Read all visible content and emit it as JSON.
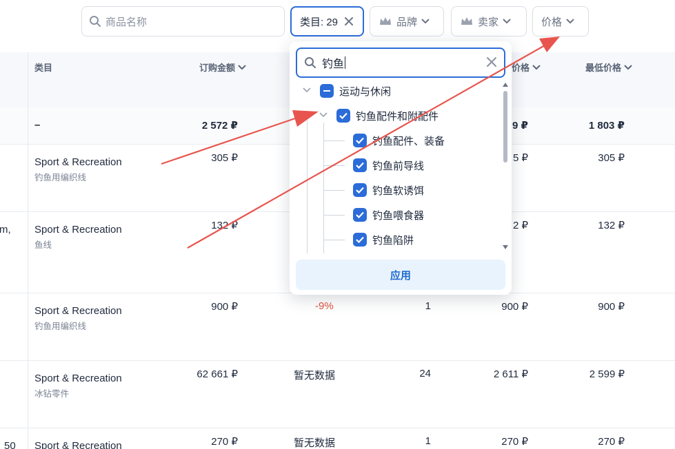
{
  "filters": {
    "search_placeholder": "商品名称",
    "category_chip": "类目: 29",
    "brand_chip": "品牌",
    "seller_chip": "卖家",
    "price_chip": "价格"
  },
  "columns": {
    "category": "类目",
    "order_amount": "订购金额",
    "price": "价格",
    "min_price": "最低价格"
  },
  "total_row": {
    "category": "–",
    "order_amount": "2 572 ₽",
    "price": "9 ₽",
    "min_price": "1 803 ₽"
  },
  "rows": [
    {
      "left": "",
      "category": "Sport & Recreation",
      "subcategory": "钓鱼用编织线",
      "order_amount": "305 ₽",
      "change": "",
      "count": "",
      "price": "5 ₽",
      "min_price": "305 ₽"
    },
    {
      "left": "m,",
      "category": "Sport & Recreation",
      "subcategory": "鱼线",
      "order_amount": "132 ₽",
      "change": "",
      "count": "",
      "price": "2 ₽",
      "min_price": "132 ₽"
    },
    {
      "left": "",
      "category": "Sport & Recreation",
      "subcategory": "钓鱼用编织线",
      "order_amount": "900 ₽",
      "change": "-9%",
      "count": "1",
      "price": "900 ₽",
      "min_price": "900 ₽"
    },
    {
      "left": "",
      "category": "Sport & Recreation",
      "subcategory": "冰钻零件",
      "order_amount": "62 661 ₽",
      "change": "暂无数据",
      "count": "24",
      "price": "2 611 ₽",
      "min_price": "2 599 ₽"
    },
    {
      "left": "50",
      "category": "Sport & Recreation",
      "subcategory": "",
      "order_amount": "270 ₽",
      "change": "暂无数据",
      "count": "1",
      "price": "270 ₽",
      "min_price": "270 ₽"
    }
  ],
  "popup": {
    "search_value": "钓鱼",
    "tree": [
      {
        "label": "运动与休闲",
        "level": 0,
        "state": "partial"
      },
      {
        "label": "钓鱼配件和附配件",
        "level": 1,
        "state": "checked"
      },
      {
        "label": "钓鱼配件、装备",
        "level": 2,
        "state": "checked"
      },
      {
        "label": "钓鱼前导线",
        "level": 2,
        "state": "checked"
      },
      {
        "label": "钓鱼软诱饵",
        "level": 2,
        "state": "checked"
      },
      {
        "label": "钓鱼喂食器",
        "level": 2,
        "state": "checked"
      },
      {
        "label": "钓鱼陷阱",
        "level": 2,
        "state": "checked"
      }
    ],
    "apply_label": "应用"
  },
  "colors": {
    "accent": "#2b6cd8",
    "negative": "#e0533a",
    "annotation_arrow": "#e8554e"
  }
}
